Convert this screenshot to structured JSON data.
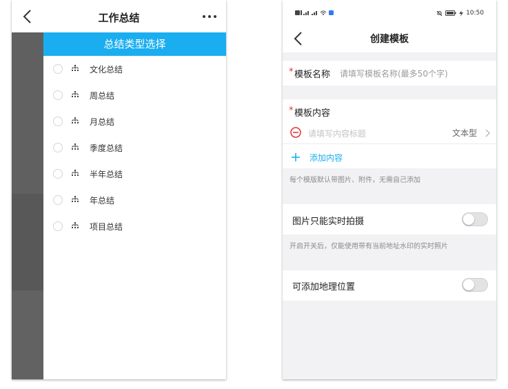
{
  "left_phone": {
    "header": {
      "title": "工作总结"
    },
    "banner": "总结类型选择",
    "items": [
      {
        "label": "文化总结"
      },
      {
        "label": "周总结"
      },
      {
        "label": "月总结"
      },
      {
        "label": "季度总结"
      },
      {
        "label": "半年总结"
      },
      {
        "label": "年总结"
      },
      {
        "label": "项目总结"
      }
    ]
  },
  "right_phone": {
    "status_bar": {
      "time": "10:50"
    },
    "nav": {
      "title": "创建模板"
    },
    "template_name": {
      "required_mark": "*",
      "label": "模板名称",
      "placeholder": "请填写模板名称(最多50个字)"
    },
    "template_content": {
      "required_mark": "*",
      "label": "模板内容",
      "entry_placeholder": "请填写内容标题",
      "entry_type": "文本型",
      "add_label": "添加内容"
    },
    "content_note": "每个模版默认带图片、附件，无需自己添加",
    "photo_toggle": {
      "label": "图片只能实时拍摄",
      "on": false
    },
    "photo_note": "开启开关后，仅能使用带有当前地址水印的实时照片",
    "location_toggle": {
      "label": "可添加地理位置",
      "on": false
    },
    "colors": {
      "accent": "#1aaef0",
      "required": "#e03131",
      "danger": "#e03131"
    }
  }
}
